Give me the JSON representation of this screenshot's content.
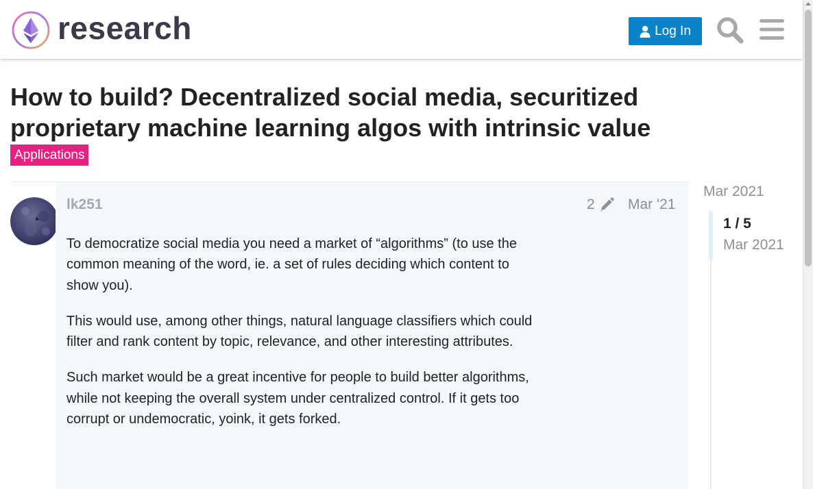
{
  "header": {
    "logo_text": "research",
    "login_label": "Log In",
    "icons": {
      "logo": "ethereum-logo-icon",
      "user": "user-icon",
      "search": "search-icon",
      "menu": "hamburger-menu-icon"
    }
  },
  "topic": {
    "title": "How to build? Decentralized social media, securitized proprietary machine learning algos with intrinsic value",
    "category": "Applications",
    "category_color": "#e8207f"
  },
  "post": {
    "username": "lk251",
    "edit_count": "2",
    "date": "Mar '21",
    "paragraphs": [
      "To democratize social media you need a market of “algorithms” (to use the common meaning of the word, ie. a set of rules deciding which content to show you).",
      "This would use, among other things, natural language classifiers which could filter and rank content by topic, relevance, and other interesting attributes.",
      "Such market would be a great incentive for people to build better algorithms, while not keeping the overall system under centralized control. If it gets too corrupt or undemocratic, yoink, it gets forked."
    ]
  },
  "timeline": {
    "start_date": "Mar 2021",
    "position": "1 / 5",
    "current_date": "Mar 2021"
  },
  "colors": {
    "accent": "#0c82c9",
    "post_background": "#f2f8fc",
    "muted_text": "#8f8f8f"
  }
}
